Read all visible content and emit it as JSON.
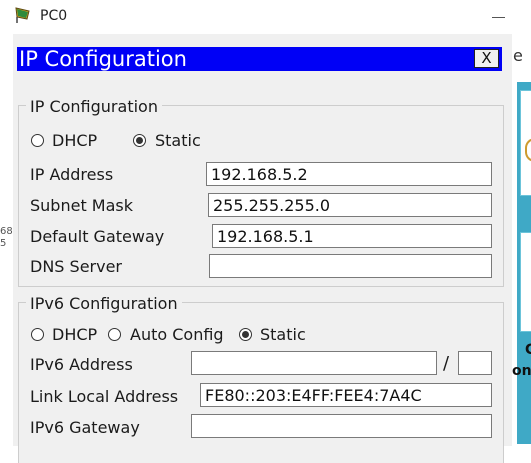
{
  "window": {
    "title": "PC0",
    "icon": "pc-device-icon"
  },
  "background": {
    "glyph": "e",
    "label_c": "C",
    "label_on": "on",
    "left_edge": [
      "68",
      "5"
    ]
  },
  "panel": {
    "title": "IP Configuration",
    "close_label": "X"
  },
  "ipv4": {
    "group_title": "IP Configuration",
    "mode_options": [
      {
        "label": "DHCP",
        "selected": false
      },
      {
        "label": "Static",
        "selected": true
      }
    ],
    "fields": {
      "ip_address": {
        "label": "IP Address",
        "value": "192.168.5.2"
      },
      "subnet_mask": {
        "label": "Subnet Mask",
        "value": "255.255.255.0"
      },
      "default_gateway": {
        "label": "Default Gateway",
        "value": "192.168.5.1"
      },
      "dns_server": {
        "label": "DNS Server",
        "value": ""
      }
    }
  },
  "ipv6": {
    "group_title": "IPv6 Configuration",
    "mode_options": [
      {
        "label": "DHCP",
        "selected": false
      },
      {
        "label": "Auto Config",
        "selected": false
      },
      {
        "label": "Static",
        "selected": true
      }
    ],
    "fields": {
      "ipv6_address": {
        "label": "IPv6 Address",
        "value": "",
        "prefix_separator": "/",
        "prefix_value": ""
      },
      "link_local_address": {
        "label": "Link Local Address",
        "value": "FE80::203:E4FF:FEE4:7A4C"
      },
      "ipv6_gateway": {
        "label": "IPv6 Gateway",
        "value": ""
      }
    }
  },
  "colors": {
    "title_bar": "#0000f6",
    "panel_bg": "#f0f0f0",
    "accent_background": "#3fa9c6"
  }
}
